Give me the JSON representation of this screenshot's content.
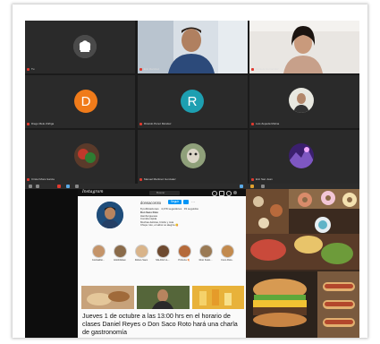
{
  "zoom": {
    "tiles": [
      {
        "name": "Tu",
        "type": "logo"
      },
      {
        "name": "Eric Ramirez",
        "type": "video"
      },
      {
        "name": "Daniela Hernandez",
        "type": "video"
      },
      {
        "name": "Diego Mele Zúñiga",
        "type": "initial",
        "initial": "D",
        "color": "#f07b1a"
      },
      {
        "name": "Ricardo Pérez Méndez",
        "type": "initial",
        "initial": "R",
        "color": "#1d9fb1"
      },
      {
        "name": "Luis Zepeda Molina",
        "type": "photo"
      },
      {
        "name": "Cristel Mora Garcia",
        "type": "photo"
      },
      {
        "name": "Manuel Martinez Gonzalez",
        "type": "photo"
      },
      {
        "name": "Eric San Juan",
        "type": "photo"
      }
    ]
  },
  "instagram": {
    "app_name": "Instagram",
    "search_placeholder": "Buscar",
    "username": "donsacoroto",
    "follow_label": "Seguir",
    "stats": {
      "posts": "8 publicaciones",
      "followers": "4,479 seguidores",
      "following": "33 seguidos"
    },
    "bio_lines": [
      "Don Saco Roto",
      "Hamburguesas",
      "Comida rápida",
      "Muchas delicias, brisbs y más",
      "Chupe roto, el sabor es alegría 😋"
    ],
    "highlights": [
      "Cocktailito...",
      "Hilobrikikan",
      "Roboo Saco",
      "SALICHI LL...",
      "Pizzeria 🍕",
      "Roto Scalo...",
      "Cono Roto.."
    ]
  },
  "caption": "Jueves 1 de octubre a las 13:00 hrs en el horario de clases Daniel Reyes o Don Saco Roto hará una charla de gastronomía",
  "colors": {
    "zoom_bg": "#1b1b1b",
    "tile_bg": "#2a2a2a",
    "ig_blue": "#0095f6"
  }
}
